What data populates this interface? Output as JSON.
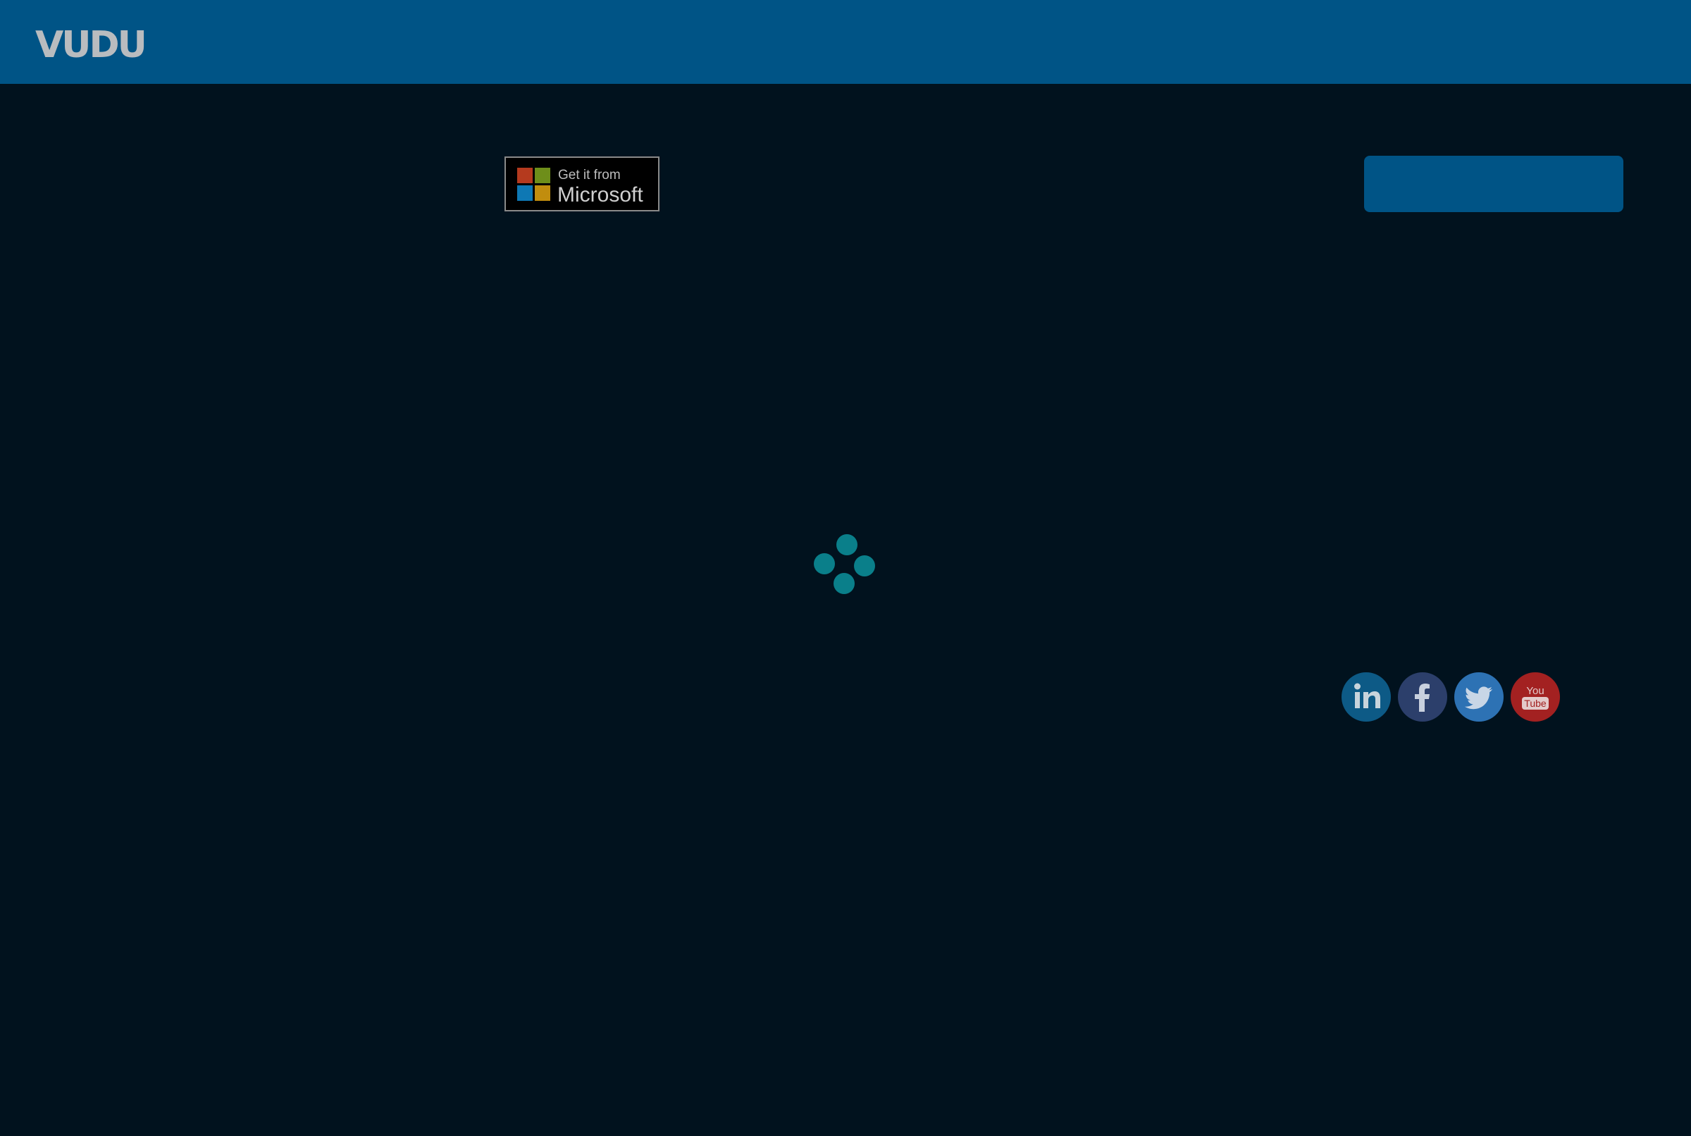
{
  "header": {
    "logo_text": "VUDU",
    "background_color": "#005486"
  },
  "store_badge": {
    "line1": "Get it from",
    "line2": "Microsoft"
  },
  "cta_button": {
    "label": "",
    "color": "#005486"
  },
  "loading_spinner": {
    "color": "#0a7f8a"
  },
  "social": [
    {
      "name": "linkedin-icon",
      "color": "#0d5a86"
    },
    {
      "name": "facebook-icon",
      "color": "#2c3f6b"
    },
    {
      "name": "twitter-icon",
      "color": "#2d72b4"
    },
    {
      "name": "youtube-icon",
      "color": "#a32121",
      "label_top": "You",
      "label_bottom": "Tube"
    }
  ],
  "page_background": "#01121e"
}
